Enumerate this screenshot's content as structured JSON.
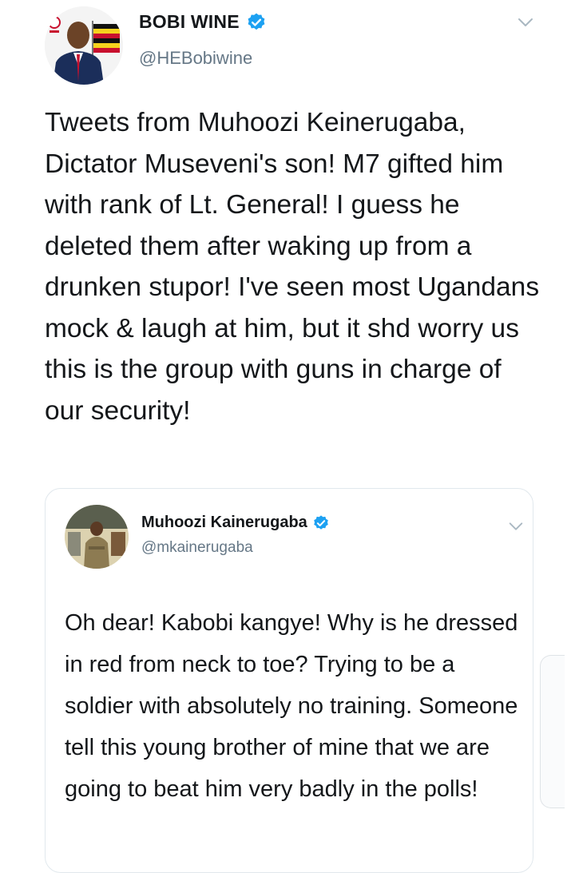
{
  "tweet": {
    "display_name": "BOBI WINE",
    "handle": "@HEBobiwine",
    "text": "Tweets from Muhoozi Keinerugaba, Dictator Museveni's son! M7 gifted him with rank of Lt. General! I guess he deleted them after waking up from a drunken stupor! I've seen most Ugandans mock & laugh at him, but it shd worry us this is the group with guns in charge of our security!",
    "verified_icon": "verified-badge-icon",
    "menu_icon": "chevron-down-icon"
  },
  "quoted_tweet": {
    "display_name": "Muhoozi Kainerugaba",
    "handle": "@mkainerugaba",
    "text": "Oh dear! Kabobi kangye! Why is he dressed in red from neck to toe? Trying to be a soldier with absolutely no training. Someone tell this young brother of mine that we are going to beat him very badly in the polls!",
    "verified_icon": "verified-badge-icon",
    "menu_icon": "chevron-down-icon"
  },
  "colors": {
    "text_primary": "#14171a",
    "text_secondary": "#657786",
    "verified_blue": "#1da1f2",
    "border": "#e1e8ed"
  }
}
